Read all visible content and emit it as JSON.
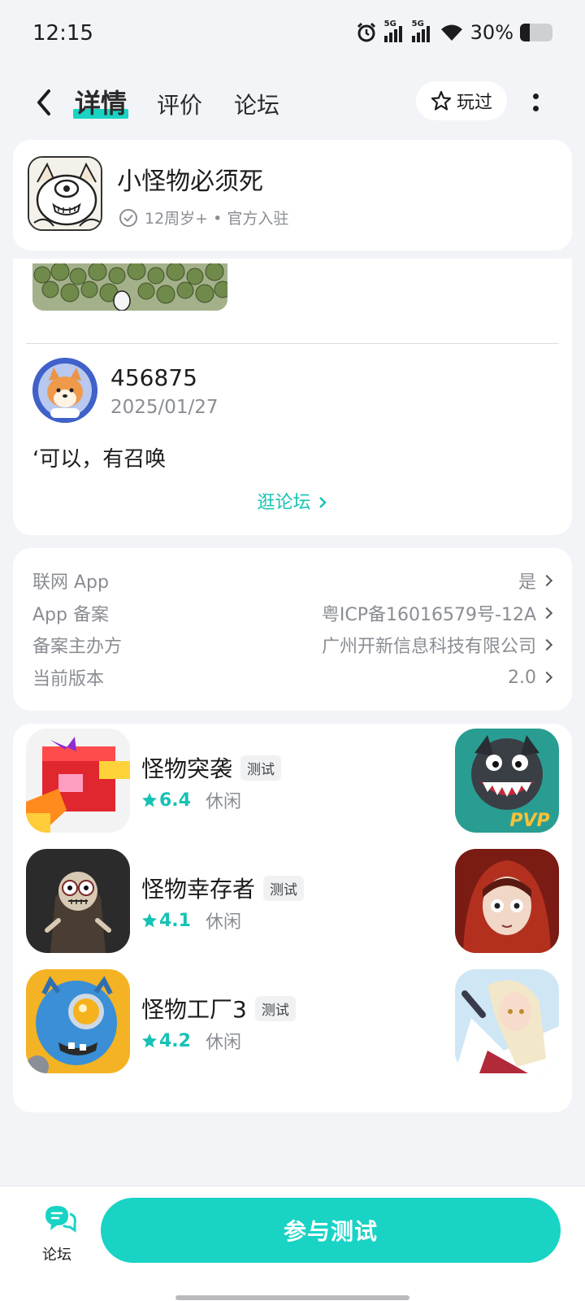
{
  "status_bar": {
    "time": "12:15",
    "net1": "5G",
    "net2": "5G",
    "battery": "30%",
    "battery_level": 0.3
  },
  "nav": {
    "tabs": [
      {
        "label": "详情",
        "active": true
      },
      {
        "label": "评价",
        "active": false
      },
      {
        "label": "论坛",
        "active": false
      }
    ],
    "played_label": "玩过"
  },
  "app": {
    "name": "小怪物必须死",
    "meta": "12周岁+ • 官方入驻"
  },
  "post": {
    "username": "456875",
    "date": "2025/01/27",
    "text": "‘可以，有召唤",
    "forum_link": "逛论坛"
  },
  "info": [
    {
      "key": "联网 App",
      "value": "是"
    },
    {
      "key": "App 备案",
      "value": "粤ICP备16016579号-12A"
    },
    {
      "key": "备案主办方",
      "value": "广州开新信息科技有限公司"
    },
    {
      "key": "当前版本",
      "value": "2.0"
    }
  ],
  "recommendations": [
    {
      "name": "怪物突袭",
      "badge": "测试",
      "score": "6.4",
      "category": "休闲"
    },
    {
      "name": "怪物幸存者",
      "badge": "测试",
      "score": "4.1",
      "category": "休闲"
    },
    {
      "name": "怪物工厂3",
      "badge": "测试",
      "score": "4.2",
      "category": "休闲"
    }
  ],
  "bottom": {
    "forum_label": "论坛",
    "join_label": "参与测试"
  },
  "colors": {
    "accent": "#19d3c5",
    "background": "#f2f4f7"
  }
}
